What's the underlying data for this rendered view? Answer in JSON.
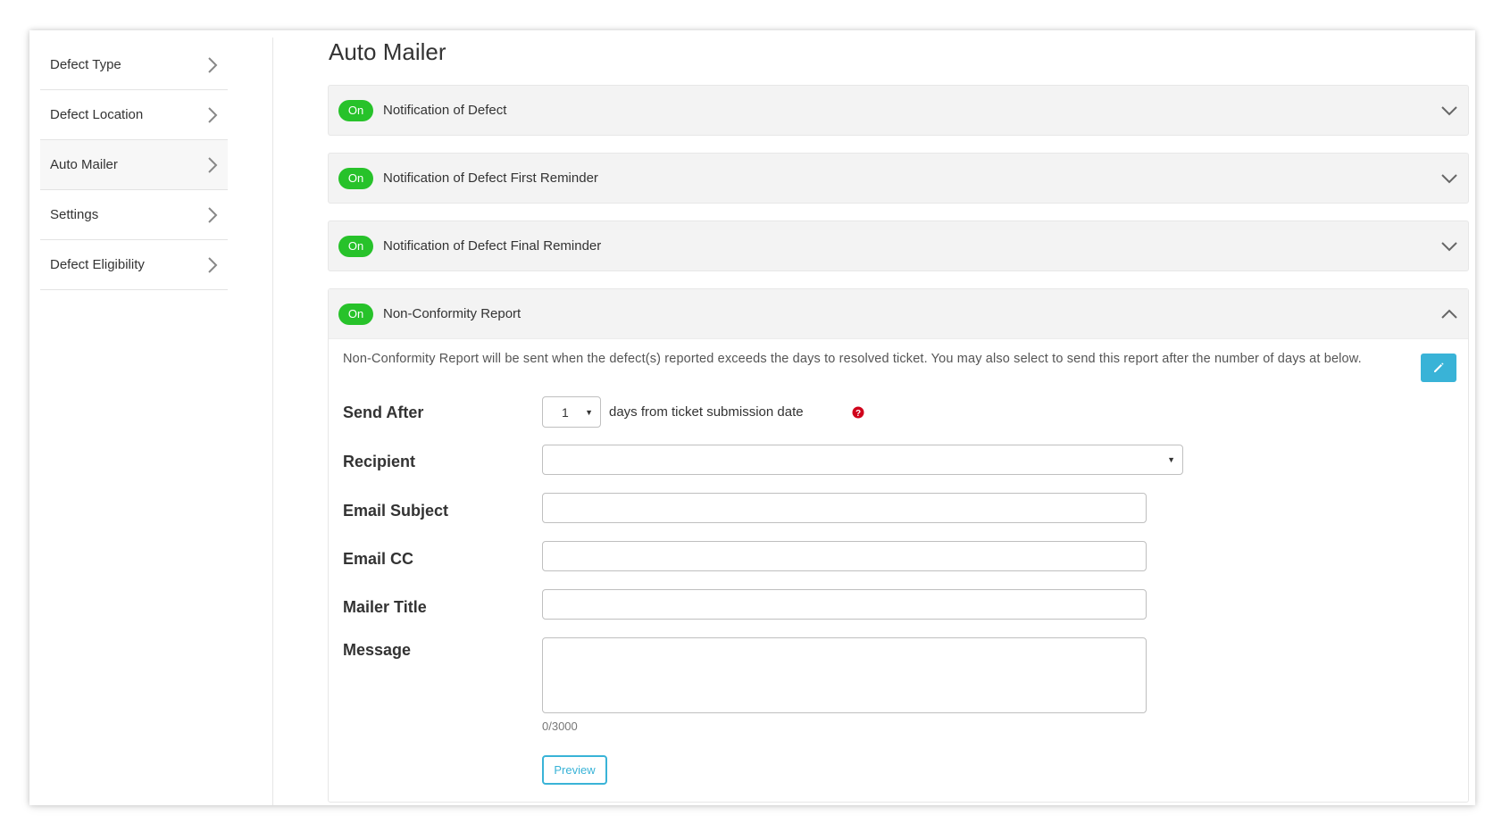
{
  "sidebar": {
    "items": [
      {
        "label": "Defect Type"
      },
      {
        "label": "Defect Location"
      },
      {
        "label": "Auto Mailer"
      },
      {
        "label": "Settings"
      },
      {
        "label": "Defect Eligibility"
      }
    ],
    "active": "Auto Mailer"
  },
  "main": {
    "title": "Auto Mailer",
    "accordions": [
      {
        "status": "On",
        "title": "Notification of Defect",
        "expanded": false
      },
      {
        "status": "On",
        "title": "Notification of Defect First Reminder",
        "expanded": false
      },
      {
        "status": "On",
        "title": "Notification of Defect Final Reminder",
        "expanded": false
      },
      {
        "status": "On",
        "title": "Non-Conformity Report",
        "expanded": true
      }
    ],
    "report": {
      "description": "Non-Conformity Report will be sent when the defect(s) reported exceeds the days to resolved ticket. You may also select to send this report after the number of days at below.",
      "send_after_label": "Send After",
      "send_after_value": "1",
      "send_after_suffix": "days from ticket submission date",
      "recipient_label": "Recipient",
      "recipient_value": "",
      "email_subject_label": "Email Subject",
      "email_subject_value": "",
      "email_cc_label": "Email CC",
      "email_cc_value": "",
      "mailer_title_label": "Mailer Title",
      "mailer_title_value": "",
      "message_label": "Message",
      "message_value": "",
      "message_counter": "0/3000",
      "preview_label": "Preview"
    }
  },
  "icons": {
    "sidebar_chevron": "chevron-right-icon",
    "accordion_collapsed": "chevron-down-icon",
    "accordion_expanded": "chevron-up-icon",
    "edit": "pencil-icon",
    "help": "question-circle-icon",
    "dropdown": "caret-down-icon"
  },
  "colors": {
    "status_on": "#27c22a",
    "accent": "#39b3d7",
    "help_icon": "#d0021b",
    "accordion_bg": "#f3f3f3"
  }
}
